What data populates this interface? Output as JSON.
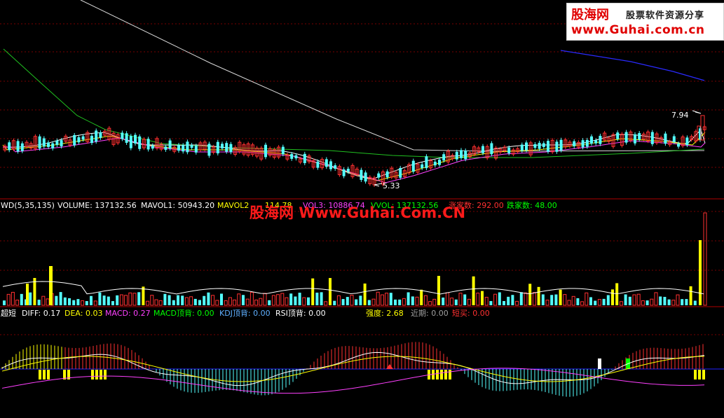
{
  "colors": {
    "background": "#000000",
    "up": "#ff3030",
    "down": "#54ffff",
    "grid": "#7a0000",
    "yellow": "#ffff00",
    "green": "#00ff00",
    "magenta": "#ff40ff",
    "blue": "#2a2aff",
    "white": "#ffffff"
  },
  "logo": {
    "main": "股海网",
    "sub": "股票软件资源分享",
    "url": "www.Guhai.com.cn"
  },
  "watermark": "股海网 Www.Guhai.Com.CN",
  "price_panel": {
    "high_marker": "7.94",
    "low_marker": "5.33"
  },
  "volume_panel": {
    "title": "WD(5,35,135)",
    "volume": "VOLUME: 137132.56",
    "mavol1": "MAVOL1: 50943.20",
    "mavol2": "MAVOL2",
    "mavol2_tail": "114.78",
    "mavol3": "VOL3: 10886.74",
    "vvol": "VVOL: 137132.56",
    "up_count": "涨家数: 292.00",
    "down_count": "跌家数: 48.00"
  },
  "macd_panel": {
    "title": "超短",
    "diff": "DIFF: 0.17",
    "dea": "DEA: 0.03",
    "macd": "MACD: 0.27",
    "macd_top": "MACD顶背: 0.00",
    "kdj_top": "KDJ顶背: 0.00",
    "rsi_top": "RSI顶背: 0.00",
    "strength": "强度: 2.68",
    "recent": "近期: 0.00",
    "short_buy": "短买: 0.00"
  }
}
